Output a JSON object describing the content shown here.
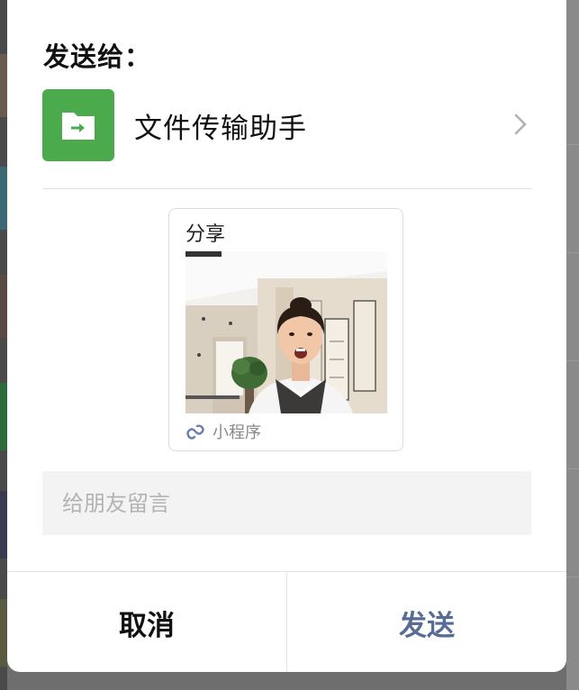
{
  "dialog": {
    "title": "发送给：",
    "recipient": {
      "name": "文件传输助手",
      "avatar_icon": "file-transfer-icon",
      "avatar_color": "#4baa4b"
    },
    "share_card": {
      "title": "分享",
      "footer_icon": "mini-program-icon",
      "footer_label": "小程序"
    },
    "message": {
      "placeholder": "给朋友留言",
      "value": ""
    },
    "buttons": {
      "cancel_label": "取消",
      "send_label": "发送",
      "send_color": "#576b95"
    }
  }
}
